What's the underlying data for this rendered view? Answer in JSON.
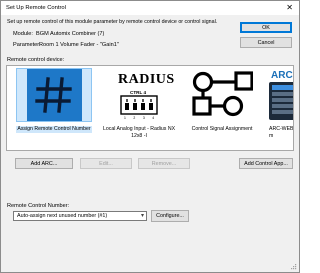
{
  "window": {
    "title": "Set Up Remote Control",
    "close_glyph": "✕"
  },
  "intro": "Set up remote control of this module parameter by remote control device or control signal.",
  "module": {
    "label": "Module:",
    "value": "BGM Automix Combiner (7)"
  },
  "parameter": {
    "label": "Parameter:",
    "value": "Room 1 Volume Fader - \"Gain1\""
  },
  "buttons": {
    "ok": "OK",
    "cancel": "Cancel",
    "add_arc": "Add ARC...",
    "edit": "Edit...",
    "remove": "Remove...",
    "add_control_app": "Add Control App...",
    "configure": "Configure..."
  },
  "device_section_label": "Remote control device:",
  "devices": [
    {
      "label": "Assign Remote Control Number",
      "icon": "hash-icon",
      "selected": true
    },
    {
      "label": "Local Analog Input - Radius NX 12x8 -I",
      "icon": "radius-device-icon",
      "selected": false
    },
    {
      "label": "Control Signal Assignment",
      "icon": "control-signal-icon",
      "selected": false
    },
    {
      "label": "ARC-WEB (A m",
      "icon": "arc-web-icon",
      "selected": false
    }
  ],
  "radius_logo_text": "RADIUS",
  "radius_ctrl_text": "CTRL 4",
  "radius_pins": "1 2 3 4",
  "arc_logo_text": "ARC",
  "number_section_label": "Remote Control Number:",
  "number_select": {
    "value": "Auto-assign next unused number (#1)"
  },
  "colors": {
    "selection_bg": "#cfe7fb",
    "hash_bg": "#1e78c8",
    "ok_border": "#0078d7"
  }
}
